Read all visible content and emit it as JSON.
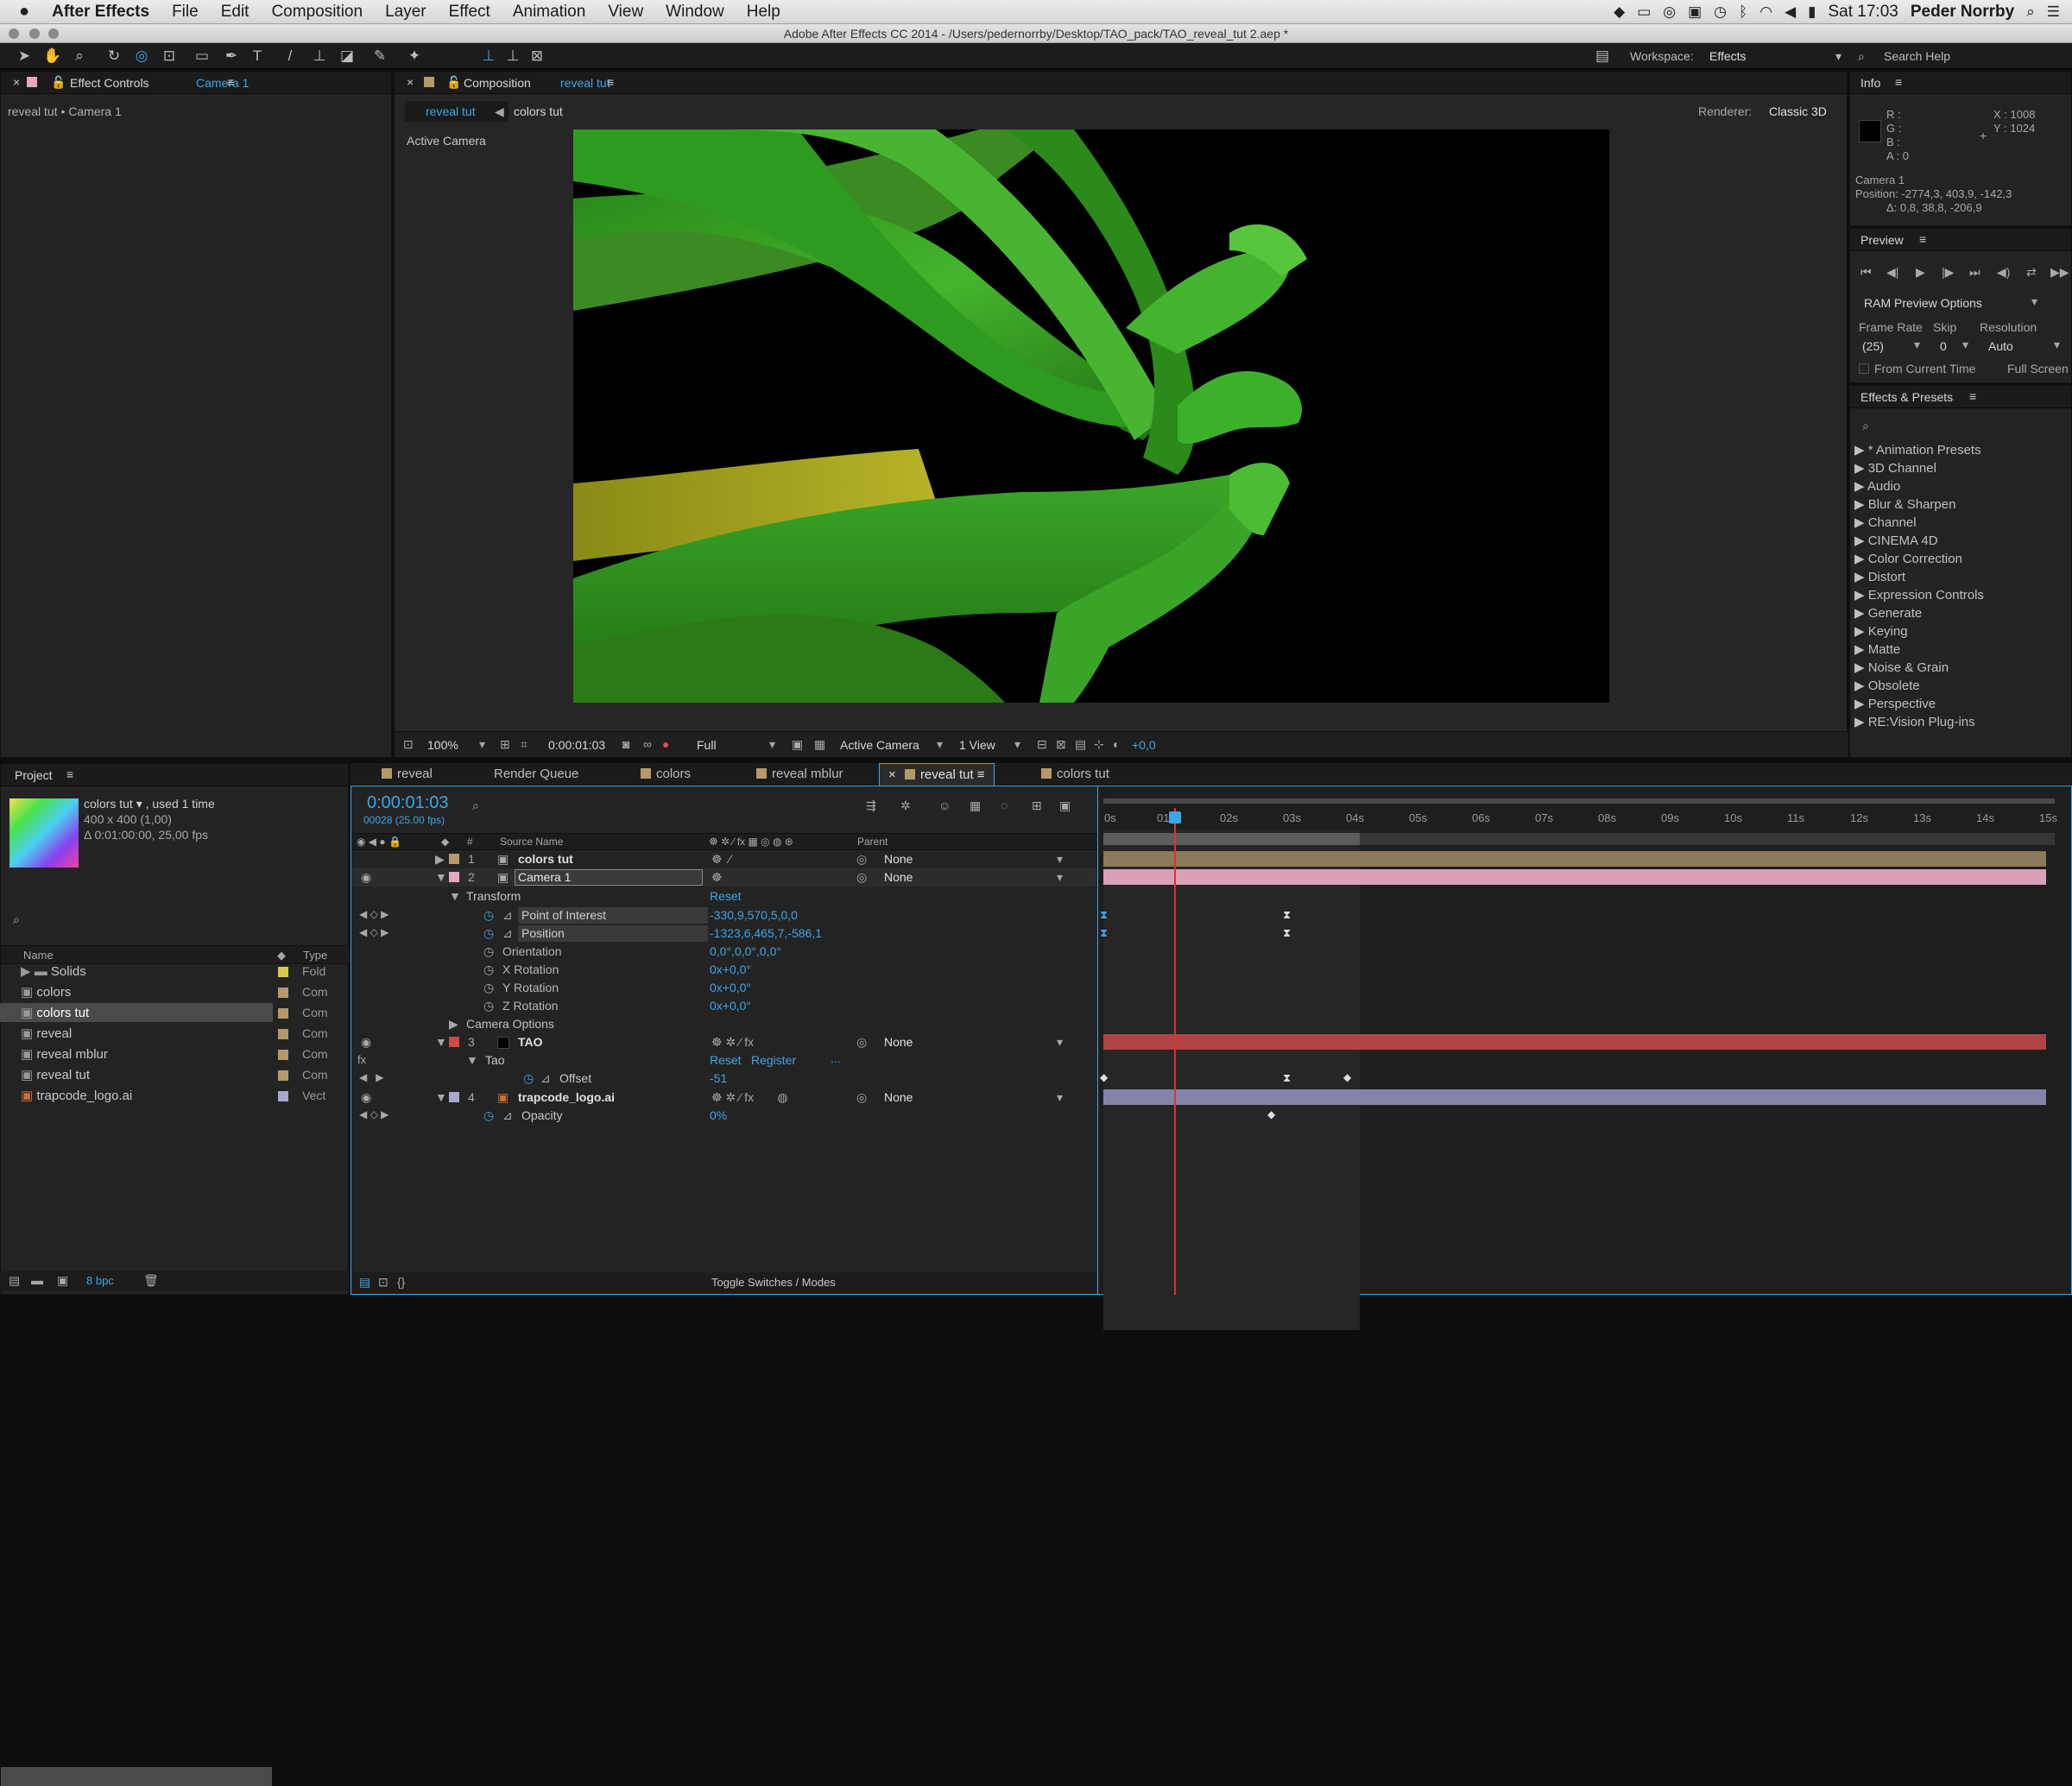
{
  "menubar": {
    "apple": "",
    "app": "After Effects",
    "items": [
      "File",
      "Edit",
      "Composition",
      "Layer",
      "Effect",
      "Animation",
      "View",
      "Window",
      "Help"
    ],
    "clock": "Sat 17:03",
    "user": "Peder Norrby"
  },
  "window": {
    "title": "Adobe After Effects CC 2014 - /Users/pedernorrby/Desktop/TAO_pack/TAO_reveal_tut 2.aep *"
  },
  "toolbar": {
    "workspace_label": "Workspace:",
    "workspace_value": "Effects",
    "search_placeholder": "Search Help"
  },
  "effect_controls": {
    "tab": "Effect Controls",
    "layer": "Camera 1",
    "breadcrumb": "reveal tut • Camera 1"
  },
  "composition": {
    "tab": "Composition",
    "comp": "reveal tut",
    "flow": [
      "reveal tut",
      "colors tut"
    ],
    "renderer_label": "Renderer:",
    "renderer": "Classic 3D",
    "view_label": "Active Camera",
    "zoom": "100%",
    "timecode": "0:00:01:03",
    "resolution": "Full",
    "camera": "Active Camera",
    "views": "1 View",
    "exposure": "+0,0"
  },
  "info": {
    "tab": "Info",
    "r": "R :",
    "g": "G :",
    "b": "B :",
    "a": "A : 0",
    "x": "X : 1008",
    "y": "Y : 1024",
    "layer": "Camera 1",
    "position": "Position: -2774,3, 403,9, -142,3",
    "delta": "Δ: 0,8, 38,8, -206,9"
  },
  "preview": {
    "tab": "Preview",
    "ram": "RAM Preview Options",
    "frame_rate_label": "Frame Rate",
    "skip_label": "Skip",
    "resolution_label": "Resolution",
    "frame_rate": "(25)",
    "skip": "0",
    "resolution": "Auto",
    "from_current": "From Current Time",
    "full_screen": "Full Screen"
  },
  "effects": {
    "tab": "Effects & Presets",
    "items": [
      "* Animation Presets",
      "3D Channel",
      "Audio",
      "Blur & Sharpen",
      "Channel",
      "CINEMA 4D",
      "Color Correction",
      "Distort",
      "Expression Controls",
      "Generate",
      "Keying",
      "Matte",
      "Noise & Grain",
      "Obsolete",
      "Perspective",
      "RE:Vision Plug-ins"
    ]
  },
  "project": {
    "tab": "Project",
    "selected_name": "colors tut ▾ , used 1 time",
    "selected_size": "400 x 400 (1,00)",
    "selected_duration": "Δ 0:01:00:00, 25,00 fps",
    "col_name": "Name",
    "col_type": "Type",
    "items": [
      {
        "name": "Solids",
        "type": "Fold",
        "color": "#d8c84a"
      },
      {
        "name": "colors",
        "type": "Com",
        "color": "#b49a6a"
      },
      {
        "name": "colors tut",
        "type": "Com",
        "color": "#b49a6a"
      },
      {
        "name": "reveal",
        "type": "Com",
        "color": "#b49a6a"
      },
      {
        "name": "reveal mblur",
        "type": "Com",
        "color": "#b49a6a"
      },
      {
        "name": "reveal tut",
        "type": "Com",
        "color": "#b49a6a"
      },
      {
        "name": "trapcode_logo.ai",
        "type": "Vect",
        "color": "#a8a8d0"
      }
    ],
    "bpc": "8 bpc"
  },
  "timeline": {
    "tabs": [
      "reveal",
      "Render Queue",
      "colors",
      "reveal mblur",
      "reveal tut",
      "colors tut"
    ],
    "timecode": "0:00:01:03",
    "frames": "00028 (25.00 fps)",
    "col_num": "#",
    "col_source": "Source Name",
    "col_parent": "Parent",
    "layers": [
      {
        "num": "1",
        "name": "colors tut",
        "parent": "None",
        "color": "#b49a6a"
      },
      {
        "num": "2",
        "name": "Camera 1",
        "parent": "None",
        "color": "#e6a8c0"
      },
      {
        "num": "3",
        "name": "TAO",
        "parent": "None",
        "color": "#d04848"
      },
      {
        "num": "4",
        "name": "trapcode_logo.ai",
        "parent": "None",
        "color": "#a8a8d0"
      }
    ],
    "transform": "Transform",
    "reset": "Reset",
    "register": "Register",
    "ellipsis": "...",
    "props": [
      {
        "name": "Point of Interest",
        "value": "-330,9,570,5,0,0"
      },
      {
        "name": "Position",
        "value": "-1323,6,465,7,-586,1"
      },
      {
        "name": "Orientation",
        "value": "0,0°,0,0°,0,0°"
      },
      {
        "name": "X Rotation",
        "value": "0x+0,0°"
      },
      {
        "name": "Y Rotation",
        "value": "0x+0,0°"
      },
      {
        "name": "Z Rotation",
        "value": "0x+0,0°"
      }
    ],
    "camera_options": "Camera Options",
    "tao": "Tao",
    "offset_name": "Offset",
    "offset_value": "-51",
    "opacity_name": "Opacity",
    "opacity_value": "0%",
    "ruler": [
      "0s",
      "01s",
      "02s",
      "03s",
      "04s",
      "05s",
      "06s",
      "07s",
      "08s",
      "09s",
      "10s",
      "11s",
      "12s",
      "13s",
      "14s",
      "15s"
    ],
    "toggle": "Toggle Switches / Modes"
  }
}
